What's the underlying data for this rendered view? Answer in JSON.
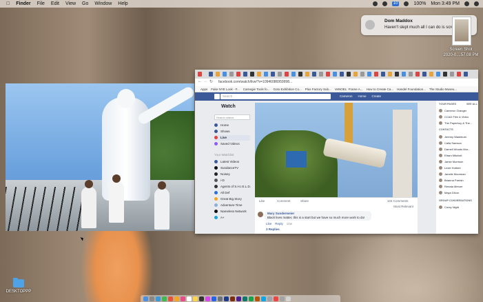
{
  "menubar": {
    "apple": "",
    "items": [
      "Finder",
      "File",
      "Edit",
      "View",
      "Go",
      "Window",
      "Help"
    ],
    "status": {
      "battery": "100%",
      "clock": "Mon 3:49 PM",
      "badge": "10"
    }
  },
  "notification": {
    "title": "Dom Maddox",
    "body": "Haven't slept much all I can do is scroll"
  },
  "desktop": {
    "screenshot_label_line1": "Screen Shot",
    "screenshot_label_line2": "2020-0....57.08 PM",
    "folder_label": "DESKTOPPP"
  },
  "browser": {
    "url": "facebook.com/watch/live/?v=10946086959998...",
    "bookmarks": [
      "Apps",
      "Fake NYE Look - F...",
      "Carnegie Tools fo...",
      "Goto Exhibition Co...",
      "Plus Factory Sub...",
      "VeNOEL: Frame A...",
      "How to Create Ca...",
      "Handel Foundation...",
      "The Studio Museu..."
    ],
    "fb": {
      "search_placeholder": "Search",
      "nav": [
        "Cameron",
        "Home",
        "Create"
      ],
      "watch_title": "Watch",
      "search_videos": "Search videos",
      "left_items": [
        "Home",
        "Shows",
        "Live",
        "Saved Videos"
      ],
      "watchlist_header": "Your Watchlist",
      "watchlist": [
        "Latest Videos",
        "SundanceTV",
        "Noisey",
        "i-D",
        "Agents of S.H.I.E.L.D.",
        "All Def",
        "Great Big Story",
        "Adventure Time",
        "Nameless Network",
        "A+"
      ],
      "actions": {
        "like": "Like",
        "comment": "Comment",
        "share": "Share",
        "counts": "104 Comments"
      },
      "most_relevant": "Most Relevant",
      "comment": {
        "author": "Mary Sundermeier",
        "text": "Black lives matter, this is a start but we have so much more work to do!",
        "like": "Like",
        "reply": "Reply",
        "time": "10w",
        "replies": "3 Replies"
      },
      "right_header_pages": "YOUR PAGES",
      "right_see_all": "SEE ALL",
      "right_pages": [
        "Cameron Granger",
        "CCAD Film & Video",
        "The Paperboy & The..."
      ],
      "contacts_header": "CONTACTS",
      "contacts": [
        "Jeremy Washburn",
        "Caila Samson",
        "Darnell Woods Mur...",
        "Efram Mitchell",
        "Jamie Morrison",
        "Lexie Holbert",
        "Janelle Moorman",
        "Brianna Parrish",
        "Renata Mercer",
        "Maya Dixon"
      ],
      "group_header": "GROUP CONVERSATIONS",
      "group": [
        "Corey Night"
      ]
    }
  }
}
